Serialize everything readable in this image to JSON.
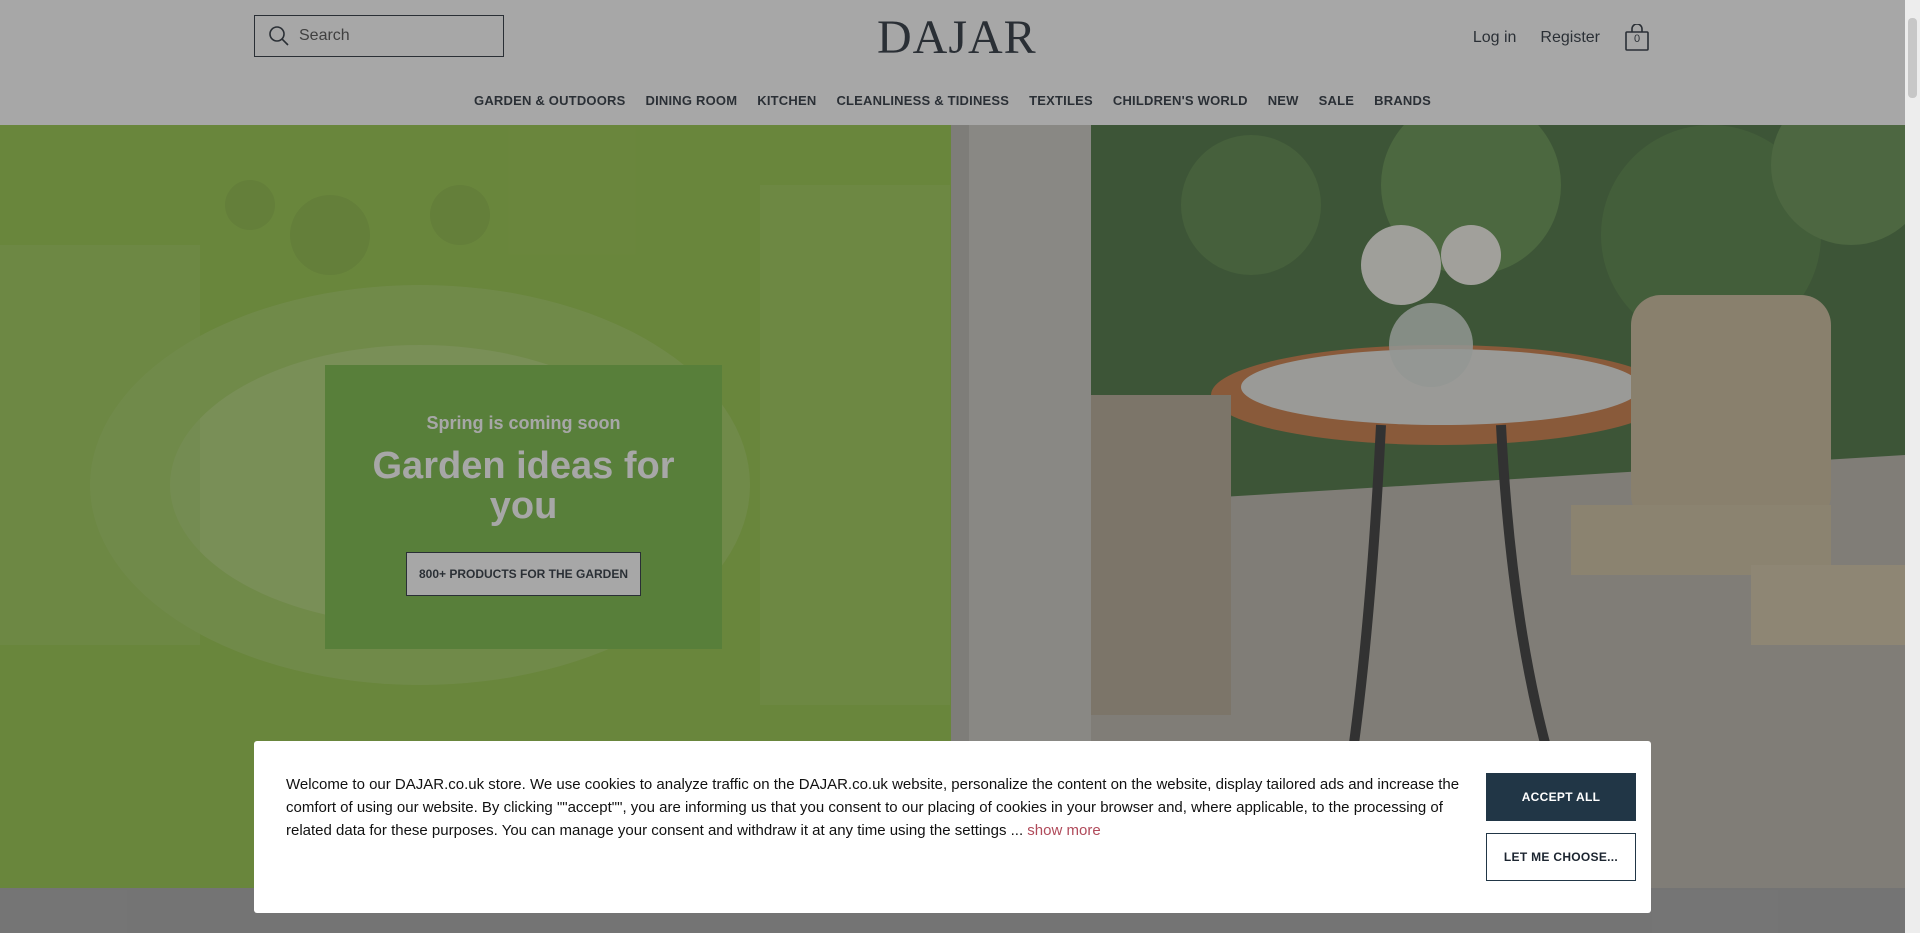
{
  "header": {
    "search": {
      "placeholder": "Search",
      "icon": "search-icon"
    },
    "logo": "DAJAR",
    "login": "Log in",
    "register": "Register",
    "cart": {
      "icon": "shopping-bag-icon",
      "count": "0"
    }
  },
  "nav": {
    "items": [
      {
        "label": "GARDEN & OUTDOORS"
      },
      {
        "label": "DINING ROOM"
      },
      {
        "label": "KITCHEN"
      },
      {
        "label": "CLEANLINESS & TIDINESS"
      },
      {
        "label": "TEXTILES"
      },
      {
        "label": "CHILDREN'S WORLD"
      },
      {
        "label": "NEW"
      },
      {
        "label": "SALE"
      },
      {
        "label": "BRANDS"
      }
    ]
  },
  "hero": {
    "kicker": "Spring is coming soon",
    "title": "Garden ideas for you",
    "cta": "800+ PRODUCTS FOR THE GARDEN",
    "colors": {
      "card": "#6fb73a",
      "left_panel": "#8fc33d"
    }
  },
  "cookie": {
    "text": "Welcome to our DAJAR.co.uk store. We use cookies to analyze traffic on the DAJAR.co.uk website, personalize the content on the website, display tailored ads and increase the comfort of using our website. By clicking \"\"accept\"\", you are informing us that you consent to our placing of cookies in your browser and, where applicable, to the processing of related data for these purposes. You can manage your consent and withdraw it at any time using the settings ...",
    "show_more": "show more",
    "accept_all": "ACCEPT ALL",
    "let_me_choose": "LET ME CHOOSE...",
    "colors": {
      "accept_bg": "#213646",
      "link": "#b04a5a"
    }
  }
}
